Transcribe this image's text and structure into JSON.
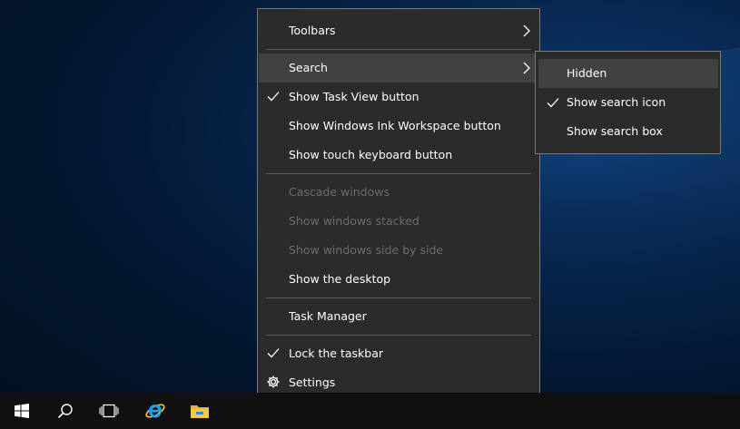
{
  "context_menu": {
    "items": [
      {
        "label": "Toolbars",
        "checked": false,
        "disabled": false,
        "submenu": true
      },
      {
        "label": "Search",
        "checked": false,
        "disabled": false,
        "submenu": true,
        "highlighted": true
      },
      {
        "label": "Show Task View button",
        "checked": true,
        "disabled": false
      },
      {
        "label": "Show Windows Ink Workspace button",
        "checked": false,
        "disabled": false
      },
      {
        "label": "Show touch keyboard button",
        "checked": false,
        "disabled": false
      },
      {
        "label": "Cascade windows",
        "checked": false,
        "disabled": true
      },
      {
        "label": "Show windows stacked",
        "checked": false,
        "disabled": true
      },
      {
        "label": "Show windows side by side",
        "checked": false,
        "disabled": true
      },
      {
        "label": "Show the desktop",
        "checked": false,
        "disabled": false
      },
      {
        "label": "Task Manager",
        "checked": false,
        "disabled": false
      },
      {
        "label": "Lock the taskbar",
        "checked": true,
        "disabled": false
      },
      {
        "label": "Settings",
        "checked": false,
        "disabled": false,
        "icon": "gear-icon"
      }
    ]
  },
  "search_submenu": {
    "items": [
      {
        "label": "Hidden",
        "checked": false,
        "highlighted": true
      },
      {
        "label": "Show search icon",
        "checked": true
      },
      {
        "label": "Show search box",
        "checked": false
      }
    ]
  },
  "taskbar": {
    "buttons": [
      {
        "name": "start-button",
        "icon": "windows-logo-icon"
      },
      {
        "name": "search-button",
        "icon": "search-icon"
      },
      {
        "name": "task-view-button",
        "icon": "task-view-icon"
      },
      {
        "name": "internet-explorer-button",
        "icon": "internet-explorer-icon"
      },
      {
        "name": "file-explorer-button",
        "icon": "folder-icon"
      }
    ]
  },
  "colors": {
    "menu_background": "#2b2b2b",
    "menu_hover": "#414141",
    "disabled_text": "#6d6d6d",
    "taskbar": "#101010",
    "ie_blue": "#1ea0e8",
    "folder_yellow": "#f2c94c"
  }
}
